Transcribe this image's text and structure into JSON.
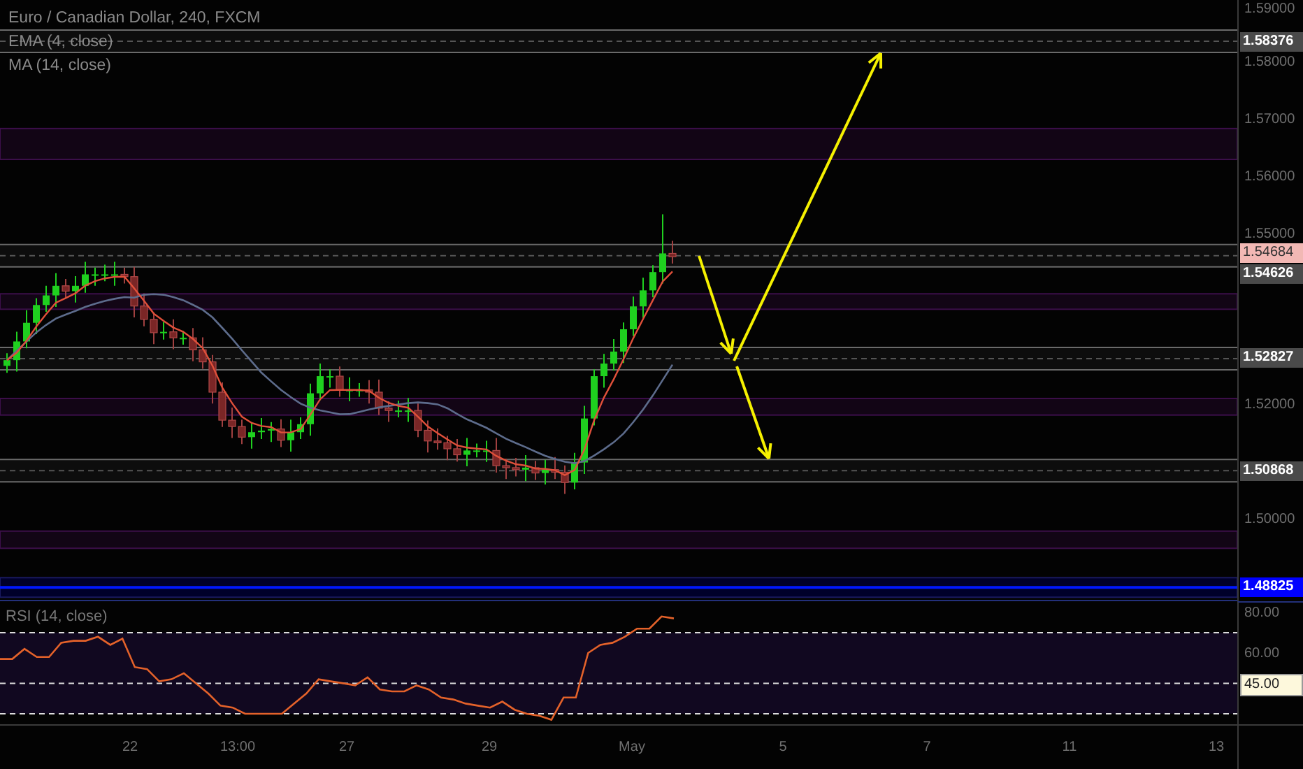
{
  "legend": [
    {
      "text": "Euro / Canadian Dollar, 240, FXCM"
    },
    {
      "text": "EMA (4, close)"
    },
    {
      "text": "MA (14, close)"
    }
  ],
  "price_axis": [
    {
      "text": "1.59000",
      "kind": "tick"
    },
    {
      "text": "1.58376",
      "kind": "level"
    },
    {
      "text": "1.58000",
      "kind": "tick"
    },
    {
      "text": "1.57000",
      "kind": "tick"
    },
    {
      "text": "1.56000",
      "kind": "tick"
    },
    {
      "text": "1.55000",
      "kind": "tick"
    },
    {
      "text": "1.54684",
      "kind": "last-price"
    },
    {
      "text": "1.54626",
      "kind": "level"
    },
    {
      "text": "1.52827",
      "kind": "level"
    },
    {
      "text": "1.52000",
      "kind": "tick"
    },
    {
      "text": "1.50868",
      "kind": "level"
    },
    {
      "text": "1.50000",
      "kind": "tick"
    },
    {
      "text": "1.48825",
      "kind": "alert"
    }
  ],
  "rsi": {
    "chart_data": {
      "type": "line",
      "ylim": [
        24.8,
        85.5
      ],
      "yticks": [
        {
          "value": 80,
          "label": "80.00"
        },
        {
          "value": 60,
          "label": "60.00"
        }
      ],
      "series": [
        {
          "name": "RSI (14, close)",
          "color": "#e4622a",
          "values": [
            57,
            57,
            62,
            58,
            58,
            65,
            66,
            66,
            68,
            64,
            67,
            53,
            52,
            46,
            47,
            50,
            45,
            40,
            34,
            33,
            30,
            30,
            30,
            30,
            35,
            40,
            47,
            46,
            45,
            44,
            48,
            42,
            41,
            41,
            44,
            42,
            38,
            37,
            35,
            34,
            33,
            36,
            32,
            30,
            29,
            27,
            38,
            38,
            60,
            64,
            65,
            68,
            72,
            72,
            78,
            77
          ]
        }
      ]
    },
    "level_marker": "45.00"
  },
  "time_axis": [
    "22",
    "13:00",
    "27",
    "29",
    "May",
    "5",
    "7",
    "11",
    "13"
  ]
}
